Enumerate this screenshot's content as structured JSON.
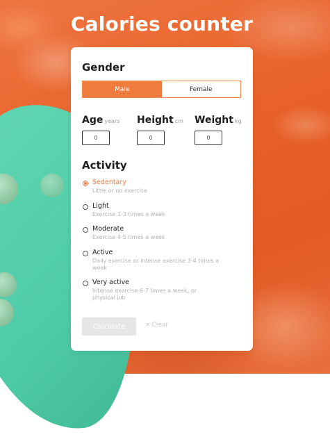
{
  "page": {
    "title": "Calories counter"
  },
  "colors": {
    "accent": "#f07b3f",
    "background": "#e8622a",
    "leaf": "#4fcba7"
  },
  "gender": {
    "title": "Gender",
    "options": [
      {
        "label": "Male",
        "selected": true
      },
      {
        "label": "Female",
        "selected": false
      }
    ]
  },
  "metrics": {
    "age": {
      "label": "Age",
      "unit": "years",
      "value": "0"
    },
    "height": {
      "label": "Height",
      "unit": "cm",
      "value": "0"
    },
    "weight": {
      "label": "Weight",
      "unit": "kg",
      "value": "0"
    }
  },
  "activity": {
    "title": "Activity",
    "selected": "Sedentary",
    "options": [
      {
        "name": "Sedentary",
        "desc": "Little or no exercise"
      },
      {
        "name": "Light",
        "desc": "Exercise 1-3 times a week"
      },
      {
        "name": "Moderate",
        "desc": "Exercise 4-5 times a week"
      },
      {
        "name": "Active",
        "desc": "Daily exercise or intense exercise 3-4 times a week"
      },
      {
        "name": "Very active",
        "desc": "Intense exercise 6-7 times a week, or physical job"
      }
    ]
  },
  "actions": {
    "calculate_label": "Calculate",
    "clear_label": "Clear",
    "clear_icon": "×"
  }
}
